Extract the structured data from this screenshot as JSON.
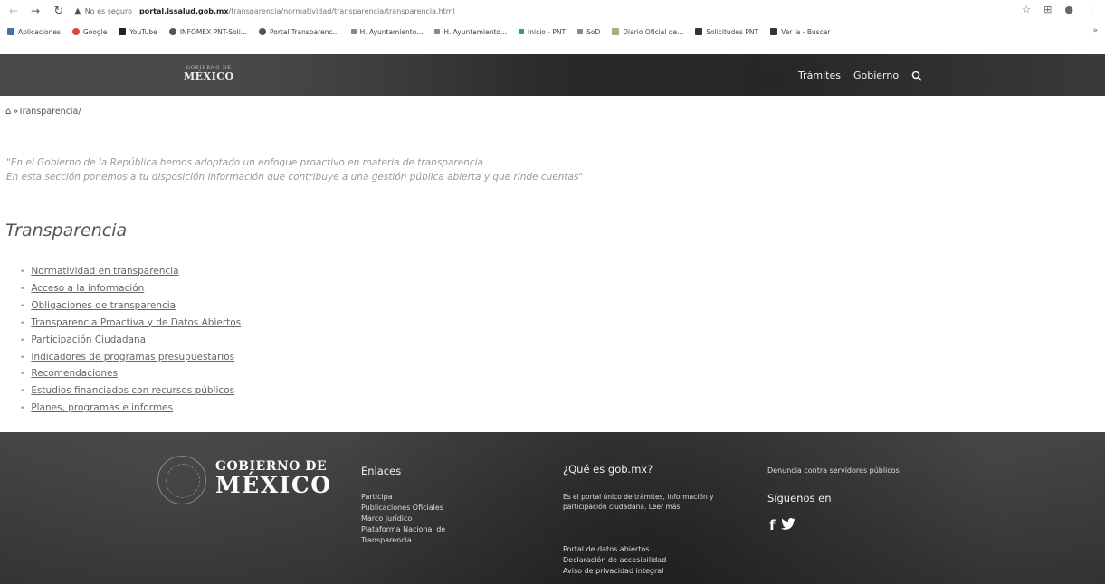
{
  "browser": {
    "secure_label": "No es seguro",
    "url_host": "portal.issalud.gob.mx",
    "url_path": "/transparencia/normatividad/transparencia/transparencia.html"
  },
  "bookmarks": [
    {
      "label": "Aplicaciones",
      "icon": "grid-icon"
    },
    {
      "label": "Google",
      "icon": "google-icon"
    },
    {
      "label": "YouTube",
      "icon": "youtube-icon"
    },
    {
      "label": "INFOMEX PNT-Soli...",
      "icon": "globe-icon"
    },
    {
      "label": "Portal Transparenc...",
      "icon": "globe-icon"
    },
    {
      "label": "H. Ayuntamiento...",
      "icon": "dot-icon"
    },
    {
      "label": "H. Ayuntamiento...",
      "icon": "dot-icon"
    },
    {
      "label": "Inicio - PNT",
      "icon": "nav-icon"
    },
    {
      "label": "SoD",
      "icon": "dot-icon"
    },
    {
      "label": "Diario Oficial de...",
      "icon": "star-icon"
    },
    {
      "label": "Solicitudes PNT",
      "icon": "dark-icon"
    },
    {
      "label": "Ver la - Buscar",
      "icon": "dark-icon"
    }
  ],
  "header": {
    "logo_small": "GOBIERNO DE",
    "logo_big": "MÉXICO",
    "nav_tramites": "Trámites",
    "nav_gobierno": "Gobierno"
  },
  "breadcrumb": {
    "separator": "»",
    "current": "Transparencia/"
  },
  "intro": {
    "line1": "\"En el Gobierno de la República hemos adoptado un enfoque proactivo en materia de transparencia",
    "line2": "En esta sección ponemos a tu disposición información que contribuye a una gestión pública abierta y que rinde cuentas\""
  },
  "section_title": "Transparencia",
  "links": [
    "Normatividad en transparencia",
    "Acceso a la información",
    "Obligaciones de transparencia",
    "Transparencia Proactiva y de Datos Abiertos",
    "Participación Ciudadana",
    "Indicadores de programas presupuestarios",
    "Recomendaciones",
    "Estudios financiados con recursos públicos",
    "Planes, programas e informes"
  ],
  "footer": {
    "logo_line1": "GOBIERNO DE",
    "logo_line2": "MÉXICO",
    "enlaces_title": "Enlaces",
    "enlaces": [
      "Participa",
      "Publicaciones Oficiales",
      "Marco Jurídico",
      "Plataforma Nacional de Transparencia"
    ],
    "gobmx_title": "¿Qué es gob.mx?",
    "gobmx_desc": "Es el portal único de trámites, información y participación ciudadana. Leer más",
    "gobmx_links": [
      "Portal de datos abiertos",
      "Declaración de accesibilidad",
      "Aviso de privacidad integral"
    ],
    "denuncia": "Denuncia contra servidores públicos",
    "siguenos": "Síguenos en"
  }
}
